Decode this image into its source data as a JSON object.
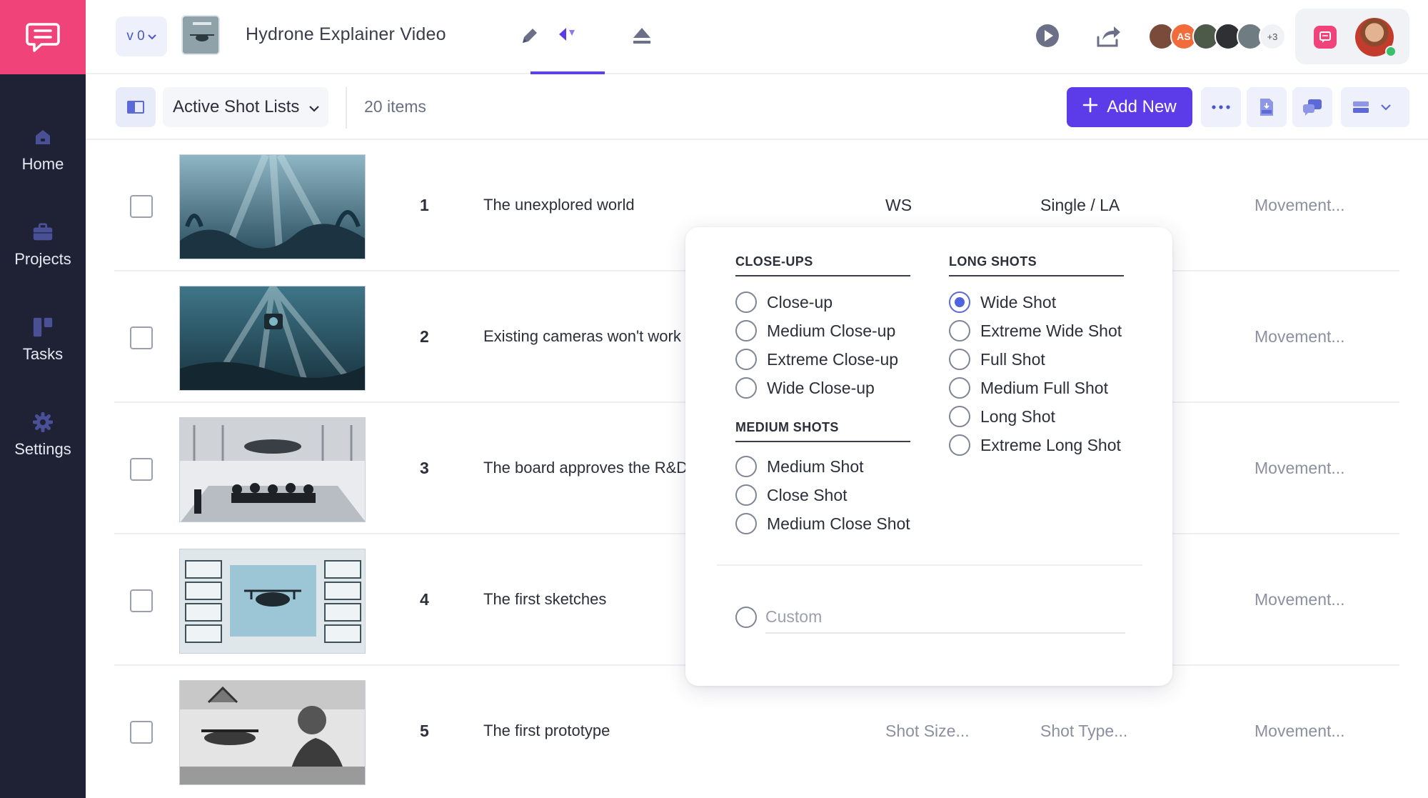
{
  "sidebar": {
    "items": [
      {
        "label": "Home",
        "icon": "home-icon"
      },
      {
        "label": "Projects",
        "icon": "briefcase-icon"
      },
      {
        "label": "Tasks",
        "icon": "tasks-icon"
      },
      {
        "label": "Settings",
        "icon": "gear-icon"
      }
    ]
  },
  "header": {
    "version": "v 0",
    "project_title": "Hydrone Explainer Video",
    "avatars": [
      {
        "initials": "",
        "color": "#7a4a3a"
      },
      {
        "initials": "AS",
        "color": "#f26b3a"
      },
      {
        "initials": "",
        "color": "#4d5a4a"
      },
      {
        "initials": "",
        "color": "#2e3033"
      },
      {
        "initials": "",
        "color": "#6f7c82"
      }
    ],
    "more_users": "+3"
  },
  "toolbar": {
    "list_name": "Active Shot Lists",
    "items_count": "20 items",
    "add_new": "Add New"
  },
  "shots": [
    {
      "num": "1",
      "desc": "The unexplored world",
      "size": "WS",
      "type": "Single / LA",
      "movement": "Movement..."
    },
    {
      "num": "2",
      "desc": "Existing cameras won't work",
      "size": "",
      "type": "",
      "movement": "Movement..."
    },
    {
      "num": "3",
      "desc": "The board approves the R&D",
      "size": "",
      "type": "",
      "movement": "Movement..."
    },
    {
      "num": "4",
      "desc": "The first sketches",
      "size": "",
      "type": "",
      "movement": "Movement..."
    },
    {
      "num": "5",
      "desc": "The first prototype",
      "size": "Shot Size...",
      "type": "Shot Type...",
      "movement": "Movement..."
    }
  ],
  "shot_size_menu": {
    "closeups_heading": "CLOSE-UPS",
    "closeups": [
      "Close-up",
      "Medium Close-up",
      "Extreme Close-up",
      "Wide Close-up"
    ],
    "medium_heading": "MEDIUM SHOTS",
    "medium": [
      "Medium Shot",
      "Close Shot",
      "Medium Close Shot"
    ],
    "long_heading": "LONG SHOTS",
    "long": [
      "Wide Shot",
      "Extreme Wide Shot",
      "Full Shot",
      "Medium Full Shot",
      "Long Shot",
      "Extreme Long Shot"
    ],
    "selected": "Wide Shot",
    "custom_placeholder": "Custom"
  },
  "colors": {
    "accent": "#5c3be8",
    "brand_pink": "#f0437a",
    "sidebar_bg": "#1f2235",
    "radio_selected": "#4f62e0"
  }
}
